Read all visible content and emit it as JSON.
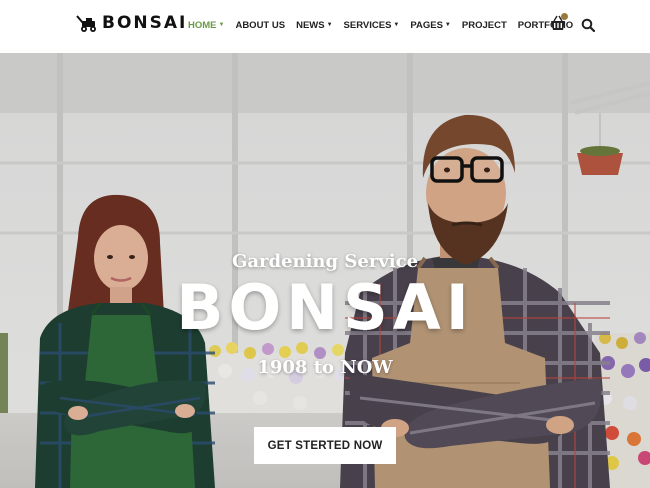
{
  "brand": {
    "name": "BONSAI",
    "logo_icon": "lawn-mower-icon"
  },
  "nav": {
    "items": [
      {
        "label": "HOME",
        "has_dropdown": true,
        "active": true
      },
      {
        "label": "ABOUT US",
        "has_dropdown": false,
        "active": false
      },
      {
        "label": "NEWS",
        "has_dropdown": true,
        "active": false
      },
      {
        "label": "SERVICES",
        "has_dropdown": true,
        "active": false
      },
      {
        "label": "PAGES",
        "has_dropdown": true,
        "active": false
      },
      {
        "label": "PROJECT",
        "has_dropdown": false,
        "active": false
      },
      {
        "label": "PORTFOLIO",
        "has_dropdown": false,
        "active": false
      }
    ],
    "caret": "▼",
    "cart_icon": "shopping-basket-icon",
    "search_icon": "search-icon"
  },
  "hero": {
    "subtitle": "Gardening Service",
    "title": "BONSAI",
    "years": "1908 to NOW",
    "cta_label": "GET STERTED NOW",
    "background": "greenhouse-photo-two-gardeners"
  },
  "colors": {
    "accent": "#6b9a45",
    "text_dark": "#222222",
    "hero_text": "#ffffff",
    "apron_green": "#2f6b3a",
    "apron_tan": "#b99a79"
  }
}
